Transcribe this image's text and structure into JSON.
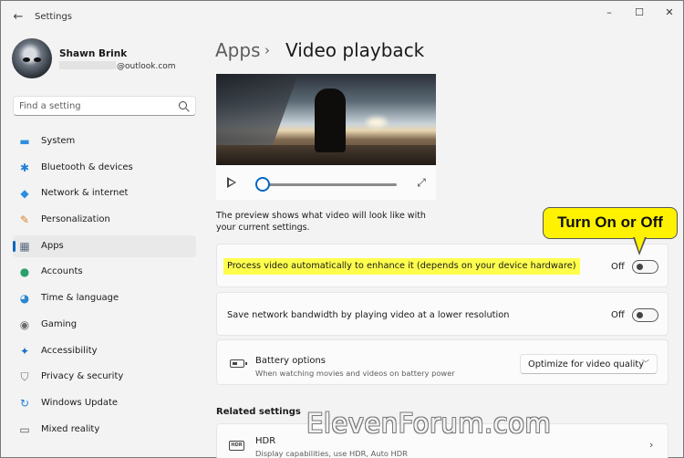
{
  "window": {
    "title": "Settings",
    "controls": {
      "minimize": "–",
      "maximize": "☐",
      "close": "✕"
    }
  },
  "profile": {
    "name": "Shawn Brink",
    "email_suffix": "@outlook.com"
  },
  "search": {
    "placeholder": "Find a setting"
  },
  "sidebar": {
    "items": [
      {
        "label": "System",
        "icon": "system-icon",
        "glyph": "▬",
        "color": "#2f8fdc"
      },
      {
        "label": "Bluetooth & devices",
        "icon": "bluetooth-icon",
        "glyph": "✱",
        "color": "#1e7fd6"
      },
      {
        "label": "Network & internet",
        "icon": "wifi-icon",
        "glyph": "◆",
        "color": "#2b8ee0"
      },
      {
        "label": "Personalization",
        "icon": "brush-icon",
        "glyph": "✎",
        "color": "#d9822b"
      },
      {
        "label": "Apps",
        "icon": "apps-icon",
        "glyph": "▦",
        "color": "#5a6b7d",
        "selected": true
      },
      {
        "label": "Accounts",
        "icon": "person-icon",
        "glyph": "●",
        "color": "#2aa06b"
      },
      {
        "label": "Time & language",
        "icon": "globe-clock-icon",
        "glyph": "◕",
        "color": "#2a86d1"
      },
      {
        "label": "Gaming",
        "icon": "gamepad-icon",
        "glyph": "◉",
        "color": "#6b6b6b"
      },
      {
        "label": "Accessibility",
        "icon": "accessibility-icon",
        "glyph": "✦",
        "color": "#1f6fc4"
      },
      {
        "label": "Privacy & security",
        "icon": "shield-icon",
        "glyph": "⛉",
        "color": "#6f6f6f"
      },
      {
        "label": "Windows Update",
        "icon": "update-icon",
        "glyph": "↻",
        "color": "#1f7fd8"
      },
      {
        "label": "Mixed reality",
        "icon": "headset-icon",
        "glyph": "▭",
        "color": "#555555"
      }
    ]
  },
  "breadcrumb": {
    "parent": "Apps",
    "separator": "›",
    "current": "Video playback"
  },
  "preview": {
    "description": "The preview shows what video will look like with your current settings.",
    "progress": 0
  },
  "settings": {
    "process_video": {
      "label": "Process video automatically to enhance it (depends on your device hardware)",
      "state": "Off"
    },
    "save_bandwidth": {
      "label": "Save network bandwidth by playing video at a lower resolution",
      "state": "Off"
    },
    "battery": {
      "title": "Battery options",
      "subtitle": "When watching movies and videos on battery power",
      "selected_option": "Optimize for video quality"
    }
  },
  "related": {
    "heading": "Related settings",
    "hdr": {
      "title": "HDR",
      "subtitle": "Display capabilities, use HDR, Auto HDR"
    }
  },
  "annotation": {
    "callout": "Turn On or Off"
  },
  "watermark": "ElevenForum.com",
  "colors": {
    "accent": "#0067c0",
    "highlight": "#fffe4d",
    "callout": "#fff200"
  }
}
